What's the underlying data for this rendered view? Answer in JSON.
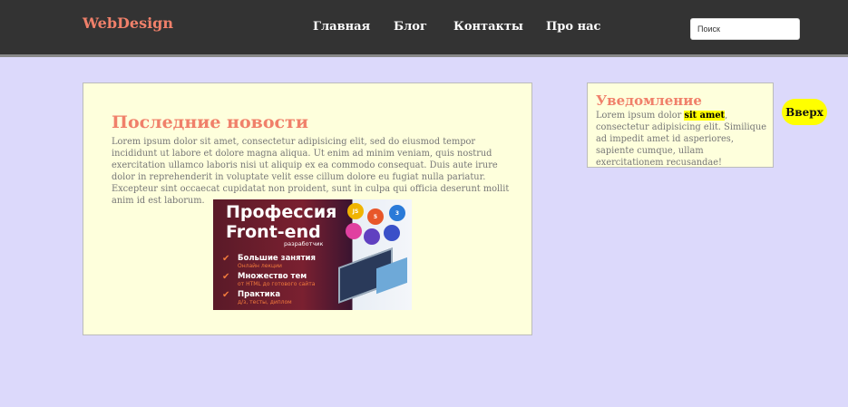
{
  "header": {
    "logo": "WebDesign",
    "nav": [
      "Главная",
      "Блог",
      "Контакты",
      "Про нас"
    ],
    "search_placeholder": "Поиск"
  },
  "main": {
    "title": "Последние новости",
    "text": "Lorem ipsum dolor sit amet, consectetur adipisicing elit, sed do eiusmod tempor incididunt ut labore et dolore magna aliqua. Ut enim ad minim veniam, quis nostrud exercitation ullamco laboris nisi ut aliquip ex ea commodo consequat. Duis aute irure dolor in reprehenderit in voluptate velit esse cillum dolore eu fugiat nulla pariatur. Excepteur sint occaecat cupidatat non proident, sunt in culpa qui officia deserunt mollit anim id est laborum.",
    "banner": {
      "title_line1": "Профессия",
      "title_line2": "Front-end",
      "subtitle": "разработчик",
      "rows": [
        {
          "head": "Большие занятия",
          "sub": "Онлайн лекции"
        },
        {
          "head": "Множество тем",
          "sub": "от HTML до готового сайта"
        },
        {
          "head": "Практика",
          "sub": "д/з, тесты, диплом"
        }
      ],
      "bubbles": [
        "JS",
        "5",
        "3"
      ]
    }
  },
  "notice": {
    "title": "Уведомление",
    "text_before": "Lorem ipsum dolor ",
    "highlight": "sit amet",
    "text_after": ", consectetur adipisicing elit. Similique ad impedit amet id asperiores, sapiente cumque, ullam exercitationem recusandae!"
  },
  "top_button": "Вверх",
  "colors": {
    "accent": "#f0806a",
    "header_bg": "#333333",
    "page_bg": "#dcd9fb",
    "box_bg": "#feffdc",
    "highlight": "#ffff00"
  }
}
